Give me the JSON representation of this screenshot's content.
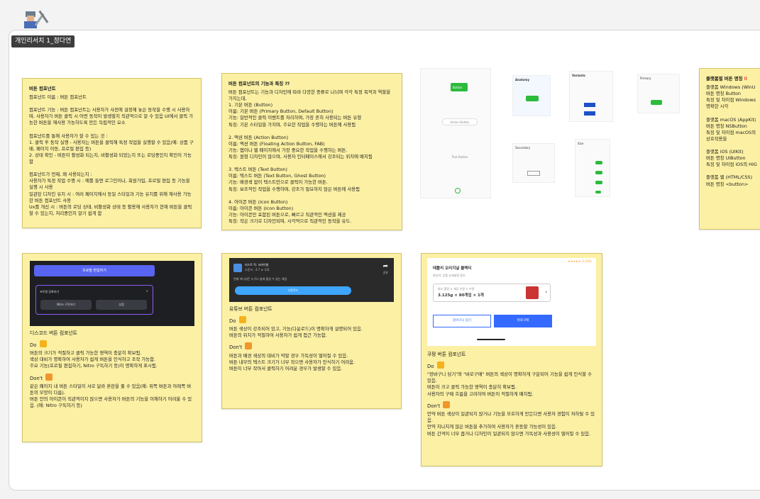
{
  "section": {
    "tag": "개인리서치 1_정다연"
  },
  "note1": {
    "title": "버튼 컴포넌트",
    "body": "컴포넌트 이름 : 버튼 컴포넌트\n\n컴포넌트 기능 : 버튼 컴포넌트는 사용자가 사전에 설정해 놓은 동작을 수행 시 사용하며, 사용자가 버튼 클릭 시 어떤 동작이 발생할지 직관적으로 알 수 있음 UI에서 클릭 가능한 버튼을 재사용 가능하도록 만든 독립적인 요소\n\n컴포넌트를 통해 사용자가 할 수 있는 것 :\n1. 클릭 후 동작 실행 - 사용자는 버튼을 클릭해 특정 작업을 실행할 수 있음(예: 상품 구매, 페이지 이동, 프로필 편집 등)\n2. 상태 확인 - 버튼이 활성화 되는지, 비활성화 되었는지 또는 로딩중인지 확인이 가능함\n\n컴포넌트가 언제, 왜 사용되는지 :\n사용자가 특정 작업 수행 시 : 예를 들면 로그인이나, 회원가입, 프로필 편집 등 기능을 실행 시 사용\n일관된 디자인 유지 시 : 여러 페이지에서 동일 스타일과 기능 유지를 위해 재사용 가능한 버튼 컴포넌트 사용\nUx를 개선 시 : 버튼의 로딩 상태, 비활성화 상태 등 활용해 사용자가 현재 버튼을 클릭할 수 있는지, 처리중인지 알기 쉽게 함"
  },
  "note2": {
    "title": "버튼 컴포넌트의 기능과 특징 ⁇",
    "body": "버튼 컴포넌트는 기능과 디자인에 따라 다양한 종류로 나뉘며 각각 특정 목적과 역할을 가지는데,\n1. 기본 버튼 (Button)\n이름: 기본 버튼 (Primary Button, Default Button)\n기능: 일반적인 클릭 이벤트를 처리하며, 가장 흔히 사용되는 버튼 유형\n특징: 기본 스타일을 가지며, 주요한 작업을 수행하는 버튼에 사용됨\n\n2. 액션 버튼 (Action Button)\n이름: 액션 버튼 (Floating Action Button, FAB)\n기능: 앱이나 웹 페이지에서 가장 중요한 작업을 수행하는 버튼.\n특징: 원형 디자인이 많으며, 사용자 인터페이스에서 강조되는 위치에 배치됨\n\n3. 텍스트 버튼 (Text Button)\n이름: 텍스트 버튼 (Text Button, Ghost Button)\n기능: 배경색 없이 텍스트만으로 클릭이 가능한 버튼.\n특징: 보조적인 작업을 수행하며, 강조가 필요하지 않은 버튼에 사용됨\n\n4. 아이콘 버튼 (Icon Button)\n이름: 아이콘 버튼 (Icon Button)\n기능: 아이콘만 포함된 버튼으로, 빠르고 직관적인 액션을 제공\n특징: 작은 크기로 디자인되며, 시각적으로 직관적인 동작을 유도."
  },
  "collage": {
    "button": "Button",
    "action_button": "Action Button",
    "text_button": "Text Button",
    "anatomy": "Anatomy",
    "variants": "Variants",
    "primary": "Primary",
    "secondary": "Secondary",
    "size": "Size"
  },
  "note3": {
    "title": "플랫폼별 버튼 명칭",
    "body": "플랫폼 Windows (WinU\n버튼 명칭 Button\n특징 및 차이점 Windows\n명확한 시각\n\n플랫폼 macOS (AppKit)\n버튼 명칭 NSButton\n특징 및 차이점 macOS의\n상호작용을\n\n플랫폼 iOS (UIKit)\n버튼 명칭 UIButton\n특징 및 차이점 iOS의 HIG\n\n플랫폼 웹 (HTML/CSS)\n버튼 명칭 <button>"
  },
  "discord": {
    "edit_profile": "프로필 편집하기",
    "enhance": "프로필 강화하기",
    "nitro": "Nitro 구독하기",
    "shop": "상점",
    "title": "디스코드 버튼 컴포넌트",
    "do": "Do",
    "do_text": "버튼의 크기가 적절하고 클릭 가능한 영역이 충분히 확보됨.\n색상 대비가 명확하여 사용자가 쉽게 버튼을 인식하고 조작 가능함.\n주요 기능(프로필 편집하기, Nitro 구독하기 등)이 명확하게 표시됨.",
    "dont": "Don't",
    "dont_text": "같은 페이지 내 버튼 스타일이 서로 달라 혼란을 줄 수 있음(예: 위쪽 버튼과 아래쪽 버튼의 모양이 다름).\n버튼 안의 아이콘이 직관적이지 않으면 사용자가 버튼의 기능을 이해하기 어려울 수 있음. (예: Nitro 구독하기 등)"
  },
  "youtube": {
    "app_name": "리스트 독: 서바이벌",
    "rating": "소문서 · 4.7 ★   무료",
    "desc": "언제 어디서든 누구나 쉽게 즐길 수 있는 게임",
    "download": "다운로드",
    "share": "공유",
    "title": "유튜브 버튼 컴포넌트",
    "do": "Do",
    "do_text": "버튼 색상이 강조되어 있고, 기능(다운로드)이 명확하게 설명되어 있음.\n버튼의 위치가 적절하여 사용자가 쉽게 접근 가능함.",
    "dont": "Don't",
    "dont_text": "버튼과 배경 색상의 대비가 약할 경우 가독성이 떨어질 수 있음.\n버튼 내부의 텍스트 크기가 너무 작으면 사용자가 인식하기 어려움.\n버튼이 너무 작아서 클릭하기 어려운 경우가 발생할 수 있음."
  },
  "coupang": {
    "rating_count": "(3,245)",
    "product": "테틀리 오리지널 블랙티",
    "sub": "원산지: 상품 상세설명 참조",
    "opt_label": "회소 중량  × 개당 수량 × 수량",
    "opt_value": "3.125g × 80개입 × 1개",
    "cart": "장바구니 담기",
    "buy": "바로구매",
    "title": "쿠팡 버튼 컴포넌트",
    "do": "Do",
    "do_text": "\"장바구니 담기\"와 \"바로구매\" 버튼의 색상이 명확하게 구분되어 기능을 쉽게 인식할 수 있음.\n버튼이 크고 클릭 가능한 영역이 충분히 확보됨.\n사용자의 구매 흐름을 고려하여 버튼이 적절하게 배치됨.",
    "dont": "Don't",
    "dont_text": "만약 버튼 색상이 일관되지 않거나 기능을 모호하게 만든다면 사용자 경험이 저하될 수 있음.\n만약 지나치게 많은 버튼을 추가하여 사용자가 혼동할 가능성이 있음.\n버튼 간격이 너무 좁거나 디자인이 일관되지 않으면 가독성과 사용성이 떨어질 수 있음."
  },
  "colors": {
    "green": "#2cbb3c",
    "discord_blurple": "#5865f2",
    "coupang_blue": "#346aff",
    "youtube_blue": "#3ea6ff",
    "sticky": "#fbf0a4"
  }
}
